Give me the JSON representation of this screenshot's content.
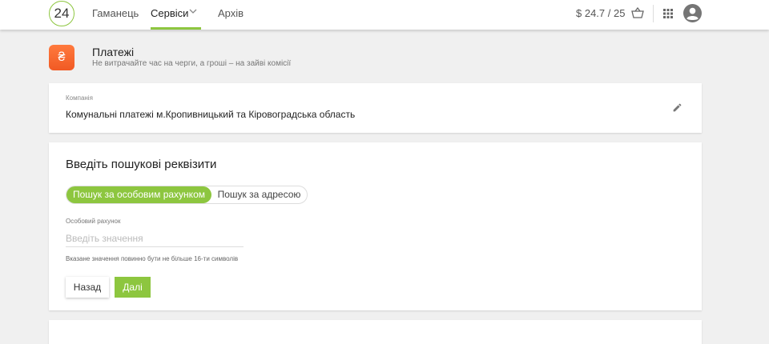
{
  "header": {
    "logo_text": "24",
    "nav": [
      {
        "label": "Гаманець"
      },
      {
        "label": "Сервіси"
      },
      {
        "label": "Архів"
      }
    ],
    "balance": "$ 24.7 / 25",
    "accent_color": "#8dc63f"
  },
  "page": {
    "icon_glyph": "₴",
    "title": "Платежі",
    "subtitle": "Не витрачайте час на черги, а гроші – на зайві комісії"
  },
  "company": {
    "label": "Компанія",
    "value": "Комунальні платежі м.Кропивницький та Кіровоградська область"
  },
  "search": {
    "heading": "Введіть пошукові реквізити",
    "tabs": [
      {
        "label": "Пошук за особовим рахунком",
        "active": true
      },
      {
        "label": "Пошук за адресою",
        "active": false
      }
    ],
    "field_label": "Особовий рахунок",
    "field_placeholder": "Введіть значення",
    "field_value": "",
    "hint": "Вказане значення повинно бути не більше 16-ти символів",
    "back_label": "Назад",
    "next_label": "Далі"
  }
}
